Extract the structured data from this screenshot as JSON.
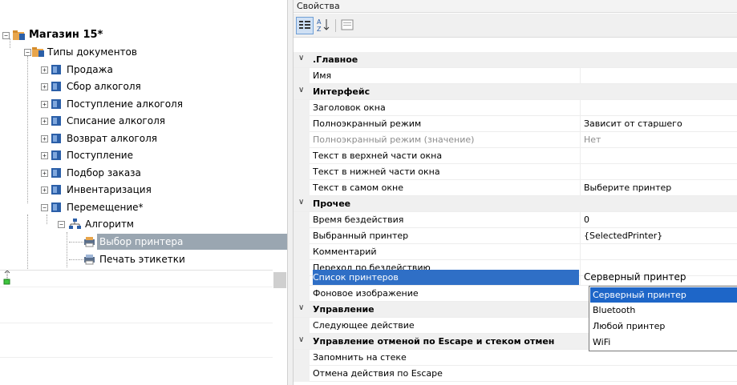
{
  "tree": {
    "root": "Магазин 15*",
    "doc_types": "Типы документов",
    "items": [
      "Продажа",
      "Сбор алкоголя",
      "Поступление алкоголя",
      "Списание алкоголя",
      "Возврат алкоголя",
      "Поступление",
      "Подбор заказа",
      "Инвентаризация",
      "Перемещение*"
    ],
    "algorithm": "Алгоритм",
    "step_selected": "Выбор принтера",
    "step_next": "Печать этикетки"
  },
  "props": {
    "title": "Свойства",
    "toolbar": [
      "categorized-icon",
      "sort-az-icon",
      "property-pages-icon"
    ],
    "categories": {
      "main": ".Главное",
      "interface": "Интерфейс",
      "other": "Прочее",
      "control": "Управление",
      "escape": "Управление отменой по Escape и стеком отмен"
    },
    "rows": {
      "name": {
        "label": "Имя",
        "value": ""
      },
      "window_title": {
        "label": "Заголовок окна",
        "value": ""
      },
      "fullscreen": {
        "label": "Полноэкранный режим",
        "value": "Зависит от старшего"
      },
      "fullscreen_value": {
        "label": "Полноэкранный режим (значение)",
        "value": "Нет"
      },
      "text_top": {
        "label": "Текст в верхней части окна",
        "value": ""
      },
      "text_bottom": {
        "label": "Текст в нижней части окна",
        "value": ""
      },
      "text_window": {
        "label": "Текст в самом окне",
        "value": "Выберите принтер"
      },
      "idle_time": {
        "label": "Время бездействия",
        "value": "0"
      },
      "selected_printer": {
        "label": "Выбранный принтер",
        "value": "{SelectedPrinter}"
      },
      "comment": {
        "label": "Комментарий",
        "value": ""
      },
      "idle_transition": {
        "label": "Переход по бездействию",
        "value": ""
      },
      "printer_list": {
        "label": "Список принтеров",
        "value": "Серверный принтер"
      },
      "background": {
        "label": "Фоновое изображение",
        "value": ""
      },
      "next_action": {
        "label": "Следующее действие",
        "value": ""
      },
      "remember_stack": {
        "label": "Запомнить на стеке",
        "value": ""
      },
      "escape_cancel": {
        "label": "Отмена действия по Escape",
        "value": ""
      }
    },
    "dropdown_options": [
      "Серверный принтер",
      "Bluetooth",
      "Любой принтер",
      "WiFi"
    ],
    "dropdown_selected": "Серверный принтер"
  },
  "colors": {
    "selection_blue": "#2f6fc6",
    "tree_selection": "#9aa6b1",
    "folder_orange": "#e8a54b",
    "doc_blue": "#2b5fa8"
  }
}
